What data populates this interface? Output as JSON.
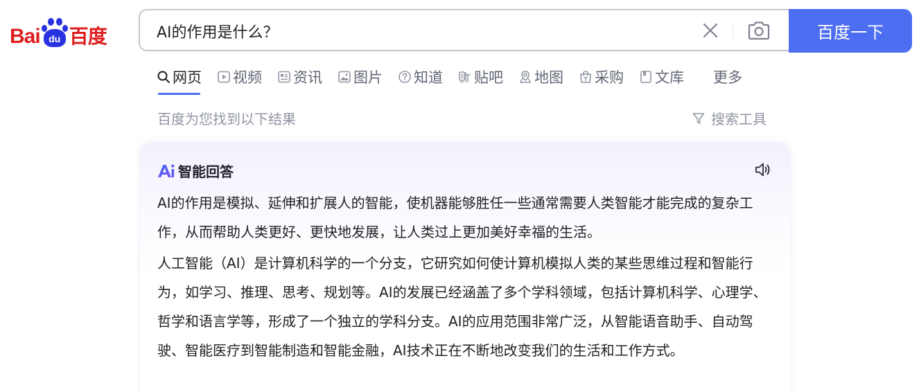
{
  "logo": {
    "text_latin": "Bai",
    "text_paw": "du",
    "text_zh": "百度",
    "colors": {
      "red": "#de1e1e",
      "blue": "#2932e1"
    }
  },
  "search": {
    "query": "AI的作用是什么？",
    "button_label": "百度一下",
    "clear_icon": "close-icon",
    "camera_icon": "camera-icon"
  },
  "tabs": [
    {
      "label": "网页",
      "icon": "search-icon",
      "active": true
    },
    {
      "label": "视频",
      "icon": "video-icon"
    },
    {
      "label": "资讯",
      "icon": "news-icon"
    },
    {
      "label": "图片",
      "icon": "image-icon"
    },
    {
      "label": "知道",
      "icon": "question-icon"
    },
    {
      "label": "贴吧",
      "icon": "tieba-icon"
    },
    {
      "label": "地图",
      "icon": "map-pin-icon"
    },
    {
      "label": "采购",
      "icon": "shopping-icon"
    },
    {
      "label": "文库",
      "icon": "document-icon"
    },
    {
      "label": "更多"
    }
  ],
  "results": {
    "count_text": "百度为您找到以下结果",
    "tools_label": "搜索工具"
  },
  "ai_answer": {
    "logo_text": "Ai",
    "title": "智能回答",
    "paragraphs": [
      "AI的作用是模拟、延伸和扩展人的智能，使机器能够胜任一些通常需要人类智能才能完成的复杂工作，从而帮助人类更好、更快地发展，让人类过上更加美好幸福的生活。",
      "人工智能（AI）是计算机科学的一个分支，它研究如何使计算机模拟人类的某些思维过程和智能行为，如学习、推理、思考、规划等。AI的发展已经涵盖了多个学科领域，包括计算机科学、心理学、哲学和语言学等，形成了一个独立的学科分支。AI的应用范围非常广泛，从智能语音助手、自动驾驶、智能医疗到智能制造和智能金融，AI技术正在不断地改变我们的生活和工作方式。"
    ]
  },
  "colors": {
    "accent": "#4e6ef2",
    "muted_text": "#9195a3",
    "tab_text": "#626675"
  }
}
